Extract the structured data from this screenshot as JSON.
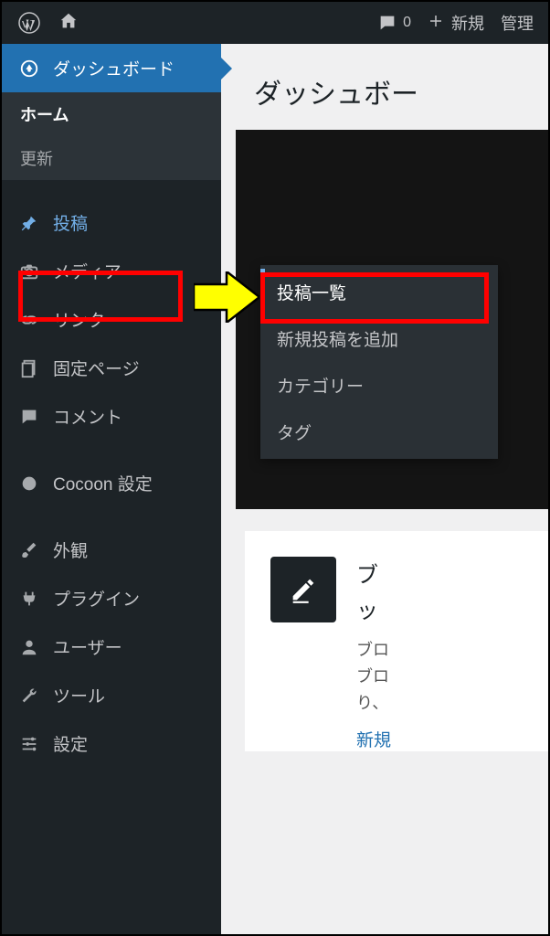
{
  "toolbar": {
    "comment_count": "0",
    "new_label": "新規",
    "admin_label": "管理"
  },
  "sidebar": {
    "dashboard": "ダッシュボード",
    "home": "ホーム",
    "updates": "更新",
    "posts": "投稿",
    "media": "メディア",
    "links": "リンク",
    "pages": "固定ページ",
    "comments": "コメント",
    "cocoon": "Cocoon 設定",
    "appearance": "外観",
    "plugins": "プラグイン",
    "users": "ユーザー",
    "tools": "ツール",
    "settings": "設定"
  },
  "flyout": {
    "all_posts": "投稿一覧",
    "add_new": "新規投稿を追加",
    "categories": "カテゴリー",
    "tags": "タグ"
  },
  "content": {
    "title": "ダッシュボー",
    "card_line1": "ブ",
    "card_line2": "ッ",
    "desc_line1": "ブロ",
    "desc_line2": "ブロ",
    "desc_line3": "り、",
    "link": "新規"
  }
}
